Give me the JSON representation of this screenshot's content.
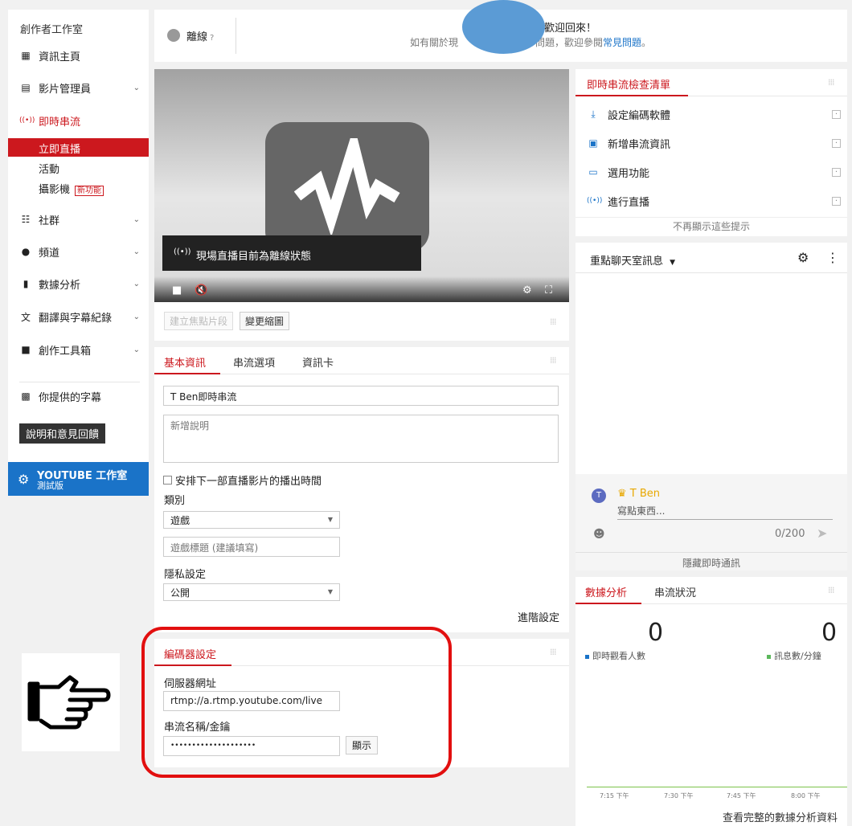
{
  "sidebar": {
    "title": "創作者工作室",
    "items": [
      {
        "icon": "dashboard-icon",
        "glyph": "▦",
        "label": "資訊主頁",
        "chevron": false
      },
      {
        "icon": "video-manager-icon",
        "glyph": "▤",
        "label": "影片管理員",
        "chevron": true
      },
      {
        "icon": "live-stream-icon",
        "glyph": "((•))",
        "label": "即時串流",
        "chevron": false
      },
      {
        "icon": "community-icon",
        "glyph": "👥",
        "label": "社群",
        "chevron": true
      },
      {
        "icon": "channel-icon",
        "glyph": "●",
        "label": "頻道",
        "chevron": true
      },
      {
        "icon": "analytics-icon",
        "glyph": "▮",
        "label": "數據分析",
        "chevron": true
      },
      {
        "icon": "translate-icon",
        "glyph": "文",
        "label": "翻譯與字幕紀錄",
        "chevron": true
      },
      {
        "icon": "creator-tools-icon",
        "glyph": "■",
        "label": "創作工具箱",
        "chevron": true
      }
    ],
    "sub_items": {
      "active": "立即直播",
      "events": "活動",
      "webcam": "攝影機",
      "new_badge": "新功能"
    },
    "your_subtitles": "你提供的字幕",
    "help_feedback": "說明和意見回饋",
    "studio_title": "YOUTUBE 工作室",
    "studio_sub": "測試版",
    "accent": "#cc181e",
    "studio_color": "#1a73c8"
  },
  "topbar": {
    "status": "離線",
    "status_help": "?",
    "welcome": "歡迎回來！",
    "sub_text": "如有關於現",
    "sub_text_2": "問題，歡迎參閱",
    "faq_link": "常見問題",
    "period": "。"
  },
  "video": {
    "offline_toast": "現場直播目前為離線狀態",
    "create_clip": "建立焦點片段",
    "change_thumbnail": "變更縮圖"
  },
  "basic_info": {
    "tabs": [
      "基本資訊",
      "串流選項",
      "資訊卡"
    ],
    "title_value": "T Ben即時串流",
    "description_placeholder": "新增說明",
    "schedule_checkbox": "安排下一部直播影片的播出時間",
    "category_label": "類別",
    "category_value": "遊戲",
    "game_title_placeholder": "遊戲標題 (建議填寫)",
    "privacy_label": "隱私設定",
    "privacy_value": "公開",
    "advanced": "進階設定"
  },
  "encoder": {
    "tab": "編碼器設定",
    "server_label": "伺服器網址",
    "server_value": "rtmp://a.rtmp.youtube.com/live",
    "key_label": "串流名稱/金鑰",
    "key_value": "••••••••••••••••••••",
    "show_button": "顯示"
  },
  "checklist": {
    "tab": "即時串流檢查清單",
    "items": [
      {
        "icon": "download-icon",
        "glyph": "⤓",
        "label": "設定編碼軟體"
      },
      {
        "icon": "stream-info-icon",
        "glyph": "▣",
        "label": "新增串流資訊"
      },
      {
        "icon": "feature-icon",
        "glyph": "▭",
        "label": "選用功能"
      },
      {
        "icon": "go-live-icon",
        "glyph": "((•))",
        "label": "進行直播"
      }
    ],
    "dismiss": "不再顯示這些提示"
  },
  "chat": {
    "header": "重點聊天室訊息",
    "author": "T Ben",
    "placeholder": "寫點東西...",
    "counter": "0/200",
    "hide": "隱藏即時通訊"
  },
  "analytics": {
    "tabs": [
      "數據分析",
      "串流狀況"
    ],
    "viewers_value": "0",
    "viewers_label": "即時觀看人數",
    "messages_value": "0",
    "messages_label": "訊息數/分鐘",
    "ticks": [
      "7:15 下午",
      "7:30 下午",
      "7:45 下午",
      "8:00 下午"
    ],
    "link": "查看完整的數據分析資料",
    "viewer_color": "#1a73c8",
    "message_color": "#5cb85c"
  }
}
